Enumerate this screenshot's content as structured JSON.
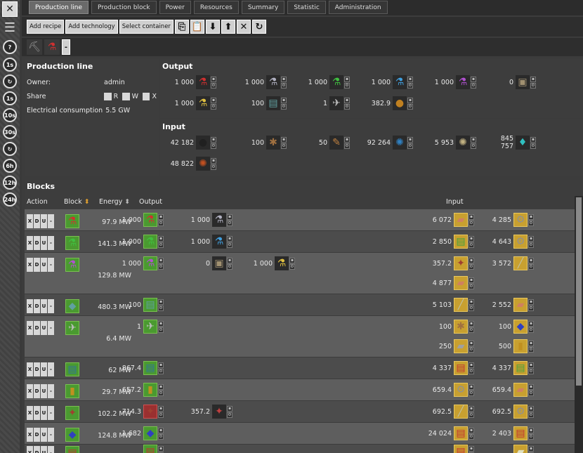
{
  "sidebar": {
    "close": "✕",
    "menu": "☰",
    "buttons": [
      "?",
      "1s",
      "↻",
      "1s",
      "10s",
      "30s",
      "↻",
      "6h",
      "12h",
      "24h"
    ]
  },
  "tabs": [
    "Production line",
    "Production block",
    "Power",
    "Resources",
    "Summary",
    "Statistic",
    "Administration"
  ],
  "toolbar": {
    "add_recipe": "Add recipe",
    "add_technology": "Add technology",
    "select_container": "Select container"
  },
  "filter": {
    "minus": "-"
  },
  "info": {
    "title": "Production line",
    "owner_label": "Owner:",
    "owner_value": "admin",
    "share_label": "Share",
    "share_r": "R",
    "share_w": "W",
    "share_x": "X",
    "elec_label": "Electrical consumption",
    "elec_value": "5.5 GW"
  },
  "output": {
    "title": "Output",
    "items": [
      {
        "n": "1 000",
        "icon": "red-science-flask-icon",
        "g": "⚗",
        "c": "#d03030"
      },
      {
        "n": "1 000",
        "icon": "gray-science-flask-icon",
        "g": "⚗",
        "c": "#b0b0c0"
      },
      {
        "n": "1 000",
        "icon": "green-science-flask-icon",
        "g": "⚗",
        "c": "#40c040"
      },
      {
        "n": "1 000",
        "icon": "blue-science-flask-icon",
        "g": "⚗",
        "c": "#40a0e0"
      },
      {
        "n": "1 000",
        "icon": "purple-science-flask-icon",
        "g": "⚗",
        "c": "#b050d0"
      },
      {
        "n": "0",
        "icon": "satellite-box-icon",
        "g": "▣",
        "c": "#a09070"
      },
      {
        "n": "1 000",
        "icon": "yellow-science-flask-icon",
        "g": "⚗",
        "c": "#e0c040"
      },
      {
        "n": "100",
        "icon": "circuit-module-icon",
        "g": "▤",
        "c": "#60a0a0"
      },
      {
        "n": "1",
        "icon": "rocket-part-icon",
        "g": "✈",
        "c": "#c0c0c0"
      },
      {
        "n": "382.9",
        "icon": "oil-drop-icon",
        "g": "●",
        "c": "#c08020"
      }
    ]
  },
  "input": {
    "title": "Input",
    "items": [
      {
        "n": "42 182",
        "icon": "coal-ore-icon",
        "g": "●",
        "c": "#202020"
      },
      {
        "n": "100",
        "icon": "wood-icon",
        "g": "✱",
        "c": "#a07040"
      },
      {
        "n": "50",
        "icon": "fish-icon",
        "g": "✎",
        "c": "#c08040"
      },
      {
        "n": "92 264",
        "icon": "water-icon",
        "g": "✺",
        "c": "#3080c0"
      },
      {
        "n": "5 953",
        "icon": "stone-icon",
        "g": "✺",
        "c": "#c0b080"
      },
      {
        "n": "845 757",
        "icon": "crude-oil-icon",
        "g": "♦",
        "c": "#30c0c0"
      },
      {
        "n": "48 822",
        "icon": "copper-ore-icon",
        "g": "✺",
        "c": "#c05020"
      }
    ]
  },
  "blocks": {
    "title": "Blocks",
    "col_action": "Action",
    "col_block": "Block",
    "col_energy": "Energy",
    "col_output": "Output",
    "col_input": "Input",
    "action_labels": [
      "X",
      "D",
      "U",
      "-"
    ],
    "rows": [
      {
        "energy": "97.9 MW",
        "out": [
          [
            "1 000",
            "red-science-flask-icon",
            "#d03030"
          ],
          [
            "1 000",
            "gray-science-flask-icon",
            "#b0b0c0"
          ]
        ],
        "in": [
          [
            "6 072",
            "copper-plate-icon",
            "#d08060"
          ],
          [
            "4 285",
            "iron-gear-icon",
            "#909090"
          ]
        ]
      },
      {
        "energy": "141.3 MW",
        "out": [
          [
            "1 000",
            "green-science-flask-icon",
            "#40c040"
          ],
          [
            "1 000",
            "blue-science-flask-icon",
            "#40a0e0"
          ]
        ],
        "in": [
          [
            "2 850",
            "electronic-circuit-icon",
            "#40a040"
          ],
          [
            "4 643",
            "iron-gear-icon",
            "#909090"
          ]
        ]
      },
      {
        "energy": "129.8 MW",
        "out": [
          [
            "1 000",
            "purple-science-flask-icon",
            "#b050d0"
          ],
          [
            "0",
            "satellite-box-icon",
            "#a09070"
          ],
          [
            "1 000",
            "yellow-science-flask-icon",
            "#e0c040"
          ]
        ],
        "in": [
          [
            "357.2",
            "engine-unit-icon",
            "#a04030"
          ],
          [
            "3 572",
            "iron-stick-icon",
            "#c0c0a0"
          ]
        ],
        "in2": [
          [
            "4 877",
            "copper-plate-icon",
            "#d08060"
          ]
        ]
      },
      {
        "energy": "480.3 MW",
        "out": [
          [
            "100",
            "circuit-module-icon",
            "#60a0a0"
          ]
        ],
        "in": [
          [
            "5 103",
            "iron-stick-icon",
            "#c0c0a0"
          ],
          [
            "2 552",
            "copper-plate-icon",
            "#d08060"
          ]
        ]
      },
      {
        "energy": "6.4 MW",
        "out": [
          [
            "1",
            "rocket-part-icon",
            "#c0c0c0"
          ]
        ],
        "in": [
          [
            "100",
            "wood-icon",
            "#a07040"
          ],
          [
            "100",
            "processing-unit-icon",
            "#3040c0"
          ]
        ],
        "in2": [
          [
            "250",
            "steel-plate-icon",
            "#a0a0a0"
          ],
          [
            "500",
            "battery-icon",
            "#c09020"
          ]
        ]
      },
      {
        "energy": "62 MW",
        "out": [
          [
            "867.4",
            "circuit-module-icon",
            "#3070a0"
          ]
        ],
        "in": [
          [
            "4 337",
            "advanced-circuit-icon",
            "#c03030"
          ],
          [
            "4 337",
            "electronic-circuit-icon",
            "#40a040"
          ]
        ]
      },
      {
        "energy": "29.7 MW",
        "out": [
          [
            "657.2",
            "battery-icon",
            "#c09020"
          ]
        ],
        "in": [
          [
            "659.4",
            "iron-gear-icon",
            "#909090"
          ],
          [
            "659.4",
            "copper-plate-icon",
            "#d08060"
          ]
        ]
      },
      {
        "energy": "102.2 MW",
        "out": [
          [
            "714.3",
            "engine-unit-icon",
            "#a04030"
          ],
          [
            "357.2",
            "electric-engine-icon",
            "#c04040"
          ]
        ],
        "in": [
          [
            "692.5",
            "iron-stick-icon",
            "#c0c0a0"
          ],
          [
            "692.5",
            "iron-gear-icon",
            "#909090"
          ]
        ]
      },
      {
        "energy": "124.8 MW",
        "out": [
          [
            "1 682",
            "processing-unit-icon",
            "#3040c0"
          ]
        ],
        "in": [
          [
            "24 024",
            "advanced-circuit-icon",
            "#c03030"
          ],
          [
            "2 403",
            "advanced-circuit-icon",
            "#c03030"
          ]
        ]
      },
      {
        "energy": "",
        "out": [
          [
            "",
            "advanced-circuit-icon",
            "#c03030"
          ]
        ],
        "in": [
          [
            "",
            "advanced-circuit-icon",
            "#c03030"
          ],
          [
            "",
            "steel-plate-icon",
            "#e0e0c0"
          ]
        ]
      }
    ]
  },
  "colors": {
    "green_block": "#4a9a30",
    "yellow_input": "#c8a030",
    "panel": "#3d3d3d"
  }
}
